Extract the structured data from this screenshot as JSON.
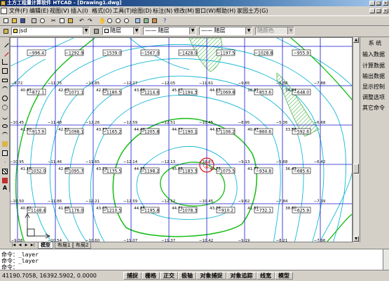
{
  "window": {
    "title": "土方工程量计算软件 HTCAD  - [Drawing1.dwg]"
  },
  "menu": [
    "文件(F)",
    "编辑(E)",
    "视图(V)",
    "插入(I)",
    "格式(O)",
    "工具(T)",
    "绘图(D)",
    "标注(N)",
    "修改(M)",
    "窗口(W)",
    "帮助(H)",
    "家园土方(G)"
  ],
  "layer_toolbar": {
    "current_layer": "jsd",
    "color": "随层",
    "linetype": "随层",
    "lineweight": "随层",
    "plotstyle": "随颜色"
  },
  "right_panel": {
    "header": "系  统",
    "items": [
      "输入数据",
      "计算数据",
      "输出数据",
      "显示控制",
      "调整选项",
      "其它命令"
    ]
  },
  "layout_tabs": [
    "模型",
    "布局1",
    "布局2"
  ],
  "command_history": [
    "命令：_layer",
    "命令：_layer"
  ],
  "command_prompt": "命令：",
  "status": {
    "coordinates": "41190.7058, 16392.5902, 0.0000",
    "toggles": [
      "捕捉",
      "栅格",
      "正交",
      "极轴",
      "对象捕捉",
      "对象追踪",
      "线宽",
      "模型"
    ]
  },
  "drawing": {
    "marker": "①",
    "colors": {
      "grid": "#1515c8",
      "text": "#000000",
      "contour": "#16b8d4",
      "contour_major": "#1fc01f",
      "hatch": "#4fb84f",
      "marker": "#e01010"
    },
    "cells": [
      {
        "r": 0,
        "c": 0,
        "cut": "−996.4",
        "fill": ""
      },
      {
        "r": 0,
        "c": 1,
        "cut": "−1292.9",
        "fill": ""
      },
      {
        "r": 0,
        "c": 2,
        "cut": "−1539.0",
        "fill": ""
      },
      {
        "r": 0,
        "c": 3,
        "cut": "−1567.0",
        "fill": ""
      },
      {
        "r": 0,
        "c": 4,
        "cut": "−1428.0",
        "fill": ""
      },
      {
        "r": 0,
        "c": 5,
        "cut": "−1197.5",
        "fill": ""
      },
      {
        "r": 0,
        "c": 6,
        "cut": "−1028.8",
        "fill": ""
      },
      {
        "r": 0,
        "c": 7,
        "cut": "−955.9",
        "fill": ""
      },
      {
        "r": 1,
        "c": 0,
        "cut": "−872.1",
        "fill": ""
      },
      {
        "r": 1,
        "c": 1,
        "cut": "−1071.1",
        "fill": ""
      },
      {
        "r": 1,
        "c": 2,
        "cut": "−1180.5",
        "fill": ""
      },
      {
        "r": 1,
        "c": 3,
        "cut": "−1214.6",
        "fill": ""
      },
      {
        "r": 1,
        "c": 4,
        "cut": "−1194.3",
        "fill": ""
      },
      {
        "r": 1,
        "c": 5,
        "cut": "−1069.8",
        "fill": ""
      },
      {
        "r": 1,
        "c": 6,
        "cut": "−853.6",
        "fill": ""
      },
      {
        "r": 1,
        "c": 7,
        "cut": "−648.0",
        "fill": ""
      },
      {
        "r": 2,
        "c": 0,
        "cut": "−913.9",
        "fill": ""
      },
      {
        "r": 2,
        "c": 1,
        "cut": "−1098.1",
        "fill": ""
      },
      {
        "r": 2,
        "c": 2,
        "cut": "−1165.2",
        "fill": ""
      },
      {
        "r": 2,
        "c": 3,
        "cut": "−1205.8",
        "fill": ""
      },
      {
        "r": 2,
        "c": 4,
        "cut": "−1190.1",
        "fill": ""
      },
      {
        "r": 2,
        "c": 5,
        "cut": "−1106.2",
        "fill": ""
      },
      {
        "r": 2,
        "c": 6,
        "cut": "−860.6",
        "fill": ""
      },
      {
        "r": 2,
        "c": 7,
        "cut": "−592.6",
        "fill": ""
      },
      {
        "r": 3,
        "c": 0,
        "cut": "−1032.0",
        "fill": ""
      },
      {
        "r": 3,
        "c": 1,
        "cut": "−1095.7",
        "fill": ""
      },
      {
        "r": 3,
        "c": 2,
        "cut": "−1135.5",
        "fill": ""
      },
      {
        "r": 3,
        "c": 3,
        "cut": "−1198.2",
        "fill": ""
      },
      {
        "r": 3,
        "c": 4,
        "cut": "−1183.3",
        "fill": ""
      },
      {
        "r": 3,
        "c": 5,
        "cut": "−1075.5",
        "fill": ""
      },
      {
        "r": 3,
        "c": 6,
        "cut": "−934.8",
        "fill": ""
      },
      {
        "r": 3,
        "c": 7,
        "cut": "−685.6",
        "fill": ""
      },
      {
        "r": 4,
        "c": 0,
        "cut": "−1148.4",
        "fill": ""
      },
      {
        "r": 4,
        "c": 1,
        "cut": "−1176.0",
        "fill": ""
      },
      {
        "r": 4,
        "c": 2,
        "cut": "−1210.5",
        "fill": ""
      },
      {
        "r": 4,
        "c": 3,
        "cut": "−1195.8",
        "fill": ""
      },
      {
        "r": 4,
        "c": 4,
        "cut": "−1078.3",
        "fill": ""
      },
      {
        "r": 4,
        "c": 5,
        "cut": "−910.2",
        "fill": ""
      },
      {
        "r": 4,
        "c": 6,
        "cut": "−732.1",
        "fill": ""
      },
      {
        "r": 4,
        "c": 7,
        "cut": "−625.9",
        "fill": ""
      }
    ],
    "point_labels": [
      {
        "col": 0,
        "row": 1,
        "t": "−9.72"
      },
      {
        "col": 1,
        "row": 1,
        "t": "−11.75"
      },
      {
        "col": 2,
        "row": 1,
        "t": "−11.85"
      },
      {
        "col": 3,
        "row": 1,
        "t": "−12.27"
      },
      {
        "col": 4,
        "row": 1,
        "t": "−12.05"
      },
      {
        "col": 5,
        "row": 1,
        "t": "−11.61"
      },
      {
        "col": 6,
        "row": 1,
        "t": "−9.65"
      },
      {
        "col": 7,
        "row": 1,
        "t": "−5.38"
      },
      {
        "col": 8,
        "row": 1,
        "t": "−7.88"
      },
      {
        "col": 0,
        "row": 2,
        "t": "−10.45"
      },
      {
        "col": 1,
        "row": 2,
        "t": "−11.48"
      },
      {
        "col": 2,
        "row": 2,
        "t": "−12.26"
      },
      {
        "col": 3,
        "row": 2,
        "t": "−12.59"
      },
      {
        "col": 4,
        "row": 2,
        "t": "−12.51"
      },
      {
        "col": 5,
        "row": 2,
        "t": "−10.45"
      },
      {
        "col": 6,
        "row": 2,
        "t": "−8.95"
      },
      {
        "col": 7,
        "row": 2,
        "t": "−5.36"
      },
      {
        "col": 8,
        "row": 2,
        "t": "−6.68"
      },
      {
        "col": 0,
        "row": 3,
        "t": "−10.95"
      },
      {
        "col": 1,
        "row": 3,
        "t": "−11.46"
      },
      {
        "col": 2,
        "row": 3,
        "t": "−11.65"
      },
      {
        "col": 3,
        "row": 3,
        "t": "−12.14"
      },
      {
        "col": 4,
        "row": 3,
        "t": "−12.13"
      },
      {
        "col": 5,
        "row": 3,
        "t": "−10.87"
      },
      {
        "col": 6,
        "row": 3,
        "t": "−9.13"
      },
      {
        "col": 7,
        "row": 3,
        "t": "−5.68"
      },
      {
        "col": 8,
        "row": 3,
        "t": "−6.42"
      },
      {
        "col": 0,
        "row": 4,
        "t": "−10.50"
      },
      {
        "col": 1,
        "row": 4,
        "t": "−11.86"
      },
      {
        "col": 2,
        "row": 4,
        "t": "−12.21"
      },
      {
        "col": 3,
        "row": 4,
        "t": "−12.59"
      },
      {
        "col": 4,
        "row": 4,
        "t": "−12.12"
      },
      {
        "col": 5,
        "row": 4,
        "t": "−10.45"
      },
      {
        "col": 6,
        "row": 4,
        "t": "−9.62"
      },
      {
        "col": 7,
        "row": 4,
        "t": "−7.84"
      },
      {
        "col": 8,
        "row": 4,
        "t": "−7.39"
      },
      {
        "col": 0,
        "row": 5,
        "t": "−9.38"
      },
      {
        "col": 1,
        "row": 5,
        "t": "−10.54"
      },
      {
        "col": 2,
        "row": 5,
        "t": "−10.60"
      },
      {
        "col": 3,
        "row": 5,
        "t": "−11.07"
      },
      {
        "col": 4,
        "row": 5,
        "t": "−11.37"
      },
      {
        "col": 5,
        "row": 5,
        "t": "−10.42"
      },
      {
        "col": 6,
        "row": 5,
        "t": "−9.19"
      },
      {
        "col": 7,
        "row": 5,
        "t": "−8.21"
      },
      {
        "col": 8,
        "row": 5,
        "t": "−7.96"
      }
    ],
    "elev_labels": [
      {
        "col": 0,
        "row": 1,
        "t": "40.41"
      },
      {
        "col": 1,
        "row": 1,
        "t": "42.01"
      },
      {
        "col": 2,
        "row": 1,
        "t": "42.20"
      },
      {
        "col": 3,
        "row": 1,
        "t": "43.66"
      },
      {
        "col": 4,
        "row": 1,
        "t": "45.07"
      },
      {
        "col": 5,
        "row": 1,
        "t": "44.12"
      },
      {
        "col": 6,
        "row": 1,
        "t": "38.91"
      },
      {
        "col": 7,
        "row": 1,
        "t": "34.94"
      },
      {
        "col": 0,
        "row": 2,
        "t": "41.50"
      },
      {
        "col": 1,
        "row": 2,
        "t": "42.52"
      },
      {
        "col": 2,
        "row": 2,
        "t": "43.77"
      },
      {
        "col": 3,
        "row": 2,
        "t": "44.46"
      },
      {
        "col": 4,
        "row": 2,
        "t": "44.77"
      },
      {
        "col": 5,
        "row": 2,
        "t": "44.15"
      },
      {
        "col": 6,
        "row": 2,
        "t": "40.47"
      },
      {
        "col": 7,
        "row": 2,
        "t": "33.56"
      },
      {
        "col": 0,
        "row": 3,
        "t": "41.16"
      },
      {
        "col": 1,
        "row": 3,
        "t": "42.46"
      },
      {
        "col": 2,
        "row": 3,
        "t": "43.29"
      },
      {
        "col": 3,
        "row": 3,
        "t": "44.35"
      },
      {
        "col": 4,
        "row": 3,
        "t": "45.86"
      },
      {
        "col": 5,
        "row": 3,
        "t": "46.75"
      },
      {
        "col": 6,
        "row": 3,
        "t": "41.77"
      },
      {
        "col": 7,
        "row": 3,
        "t": "36.43"
      },
      {
        "col": 0,
        "row": 4,
        "t": "40.62"
      },
      {
        "col": 1,
        "row": 4,
        "t": "41.66"
      },
      {
        "col": 2,
        "row": 4,
        "t": "43.03"
      },
      {
        "col": 3,
        "row": 4,
        "t": "44.85"
      },
      {
        "col": 4,
        "row": 4,
        "t": "44.71"
      },
      {
        "col": 5,
        "row": 4,
        "t": "43.26"
      },
      {
        "col": 6,
        "row": 4,
        "t": "41.31"
      },
      {
        "col": 7,
        "row": 4,
        "t": "38.60"
      },
      {
        "col": 0,
        "row": 5,
        "t": "37.50"
      },
      {
        "col": 1,
        "row": 5,
        "t": "38.24"
      },
      {
        "col": 2,
        "row": 5,
        "t": "40.32"
      },
      {
        "col": 3,
        "row": 5,
        "t": "41.17"
      },
      {
        "col": 4,
        "row": 5,
        "t": "40.66"
      },
      {
        "col": 5,
        "row": 5,
        "t": "41.05"
      },
      {
        "col": 6,
        "row": 5,
        "t": "38.68"
      },
      {
        "col": 7,
        "row": 5,
        "t": "37.49"
      }
    ]
  }
}
